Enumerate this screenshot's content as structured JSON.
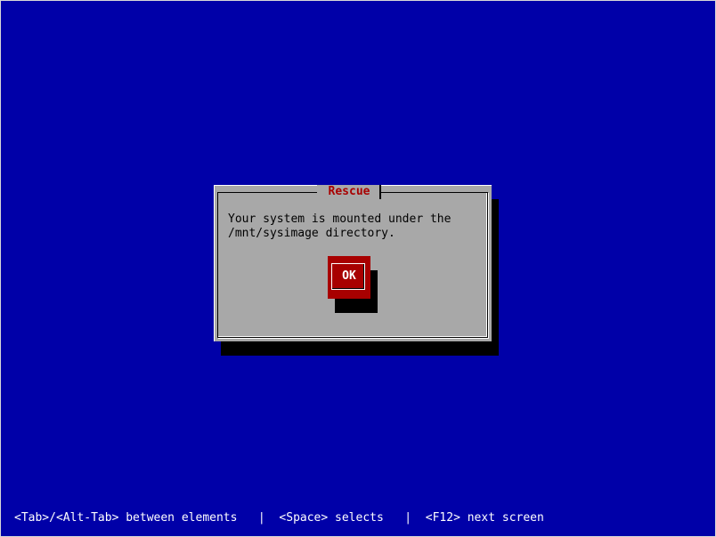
{
  "dialog": {
    "title": "Rescue",
    "message": "Your system is mounted under the\n/mnt/sysimage directory.",
    "ok_label": "OK"
  },
  "help_line": "<Tab>/<Alt-Tab> between elements   |  <Space> selects   |  <F12> next screen",
  "colors": {
    "background": "#0000a8",
    "dialog": "#a8a8a8",
    "accent": "#a80000",
    "shadow": "#000000"
  }
}
